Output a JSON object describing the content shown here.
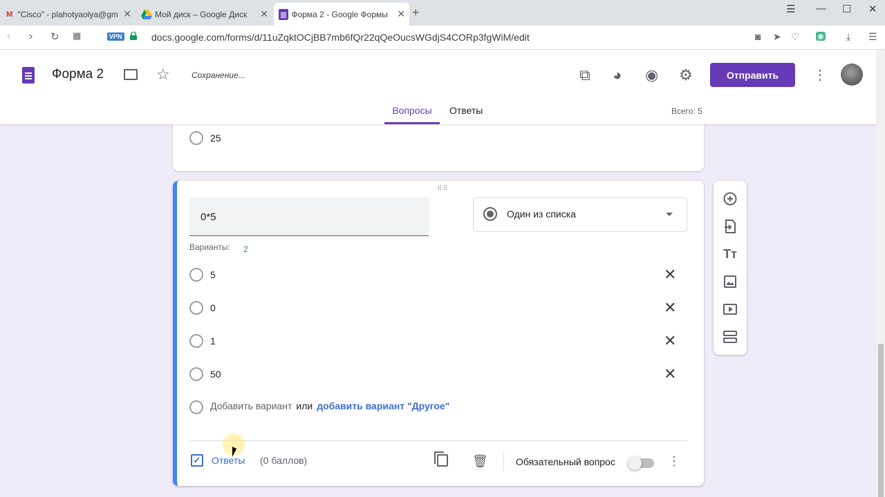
{
  "browser": {
    "tabs": [
      {
        "favicon": "gmail-icon",
        "title": "\"Cisco\" - plahotyaolya@gm"
      },
      {
        "favicon": "drive-icon",
        "title": "Мой диск – Google Диск"
      },
      {
        "favicon": "forms-icon",
        "title": "Форма 2 - Google Формы"
      }
    ],
    "vpn_label": "VPN",
    "url": "docs.google.com/forms/d/11uZqktOCjBB7mb6fQr22qQeOucsWGdjS4CORp3fgWiM/edit"
  },
  "header": {
    "form_title": "Форма 2",
    "status": "Сохранение...",
    "send_label": "Отправить",
    "tabs": {
      "questions": "Вопросы",
      "responses": "Ответы"
    },
    "total": "Всего: 5",
    "accent_color": "#673ab7"
  },
  "prev_card": {
    "option": "25"
  },
  "question": {
    "title": "0*5",
    "type": "Один из списка",
    "variants_label": "Варианты:",
    "variants_count": "2",
    "options": [
      "5",
      "0",
      "1",
      "50"
    ],
    "add_option": "Добавить вариант",
    "or": "или",
    "add_other": "добавить вариант \"Другое\"",
    "answers_label": "Ответы",
    "points": "(0 баллов)",
    "required_label": "Обязательный вопрос",
    "required": false
  }
}
